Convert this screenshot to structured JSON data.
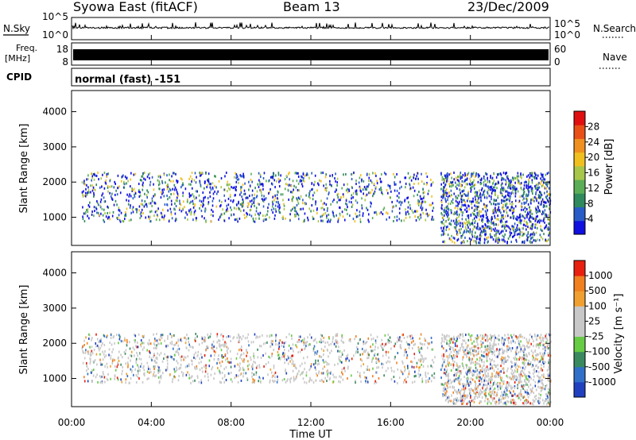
{
  "header": {
    "station": "Syowa East (fitACF)",
    "beam": "Beam 13",
    "date": "23/Dec/2009"
  },
  "top_panels": {
    "nsky_label": "N.Sky",
    "nsky_ticks": [
      "10^5",
      "10^0"
    ],
    "nsearch_label": "N.Search",
    "nsearch_ticks": [
      "10^5",
      "10^0"
    ],
    "freq_label": "Freq.",
    "freq_unit": "[MHz]",
    "freq_ticks": [
      "18",
      "8"
    ],
    "nave_label": "Nave",
    "nave_ticks": [
      "60",
      "0"
    ],
    "cpid_label": "CPID",
    "cpid_value": "normal (fast) -151"
  },
  "chart_data": [
    {
      "type": "heatmap",
      "panel": "power",
      "ylabel": "Slant Range [km]",
      "xlabel": "",
      "y_ticks": [
        "1000",
        "2000",
        "3000",
        "4000"
      ],
      "x_ticks": [
        "00:00",
        "04:00",
        "08:00",
        "12:00",
        "16:00",
        "20:00",
        "00:00"
      ],
      "ylim": [
        200,
        4600
      ],
      "xlim_hours": [
        0,
        24
      ],
      "colorbar": {
        "label": "Power [dB]",
        "ticks": [
          "4",
          "8",
          "12",
          "16",
          "20",
          "24",
          "28"
        ],
        "colors": [
          "#1010e0",
          "#2a5cc8",
          "#2f8a5e",
          "#5cae56",
          "#a8c64a",
          "#f0c020",
          "#f09020",
          "#e85018",
          "#e01010"
        ]
      },
      "scatter_bands": [
        {
          "start_h": 0.5,
          "end_h": 18.2,
          "range_km": [
            900,
            2300
          ]
        },
        {
          "start_h": 18.5,
          "end_h": 24.0,
          "range_km": [
            300,
            2300
          ]
        }
      ]
    },
    {
      "type": "heatmap",
      "panel": "velocity",
      "ylabel": "Slant Range [km]",
      "xlabel": "Time UT",
      "y_ticks": [
        "1000",
        "2000",
        "3000",
        "4000"
      ],
      "x_ticks": [
        "00:00",
        "04:00",
        "08:00",
        "12:00",
        "16:00",
        "20:00",
        "00:00"
      ],
      "ylim": [
        200,
        4600
      ],
      "xlim_hours": [
        0,
        24
      ],
      "colorbar": {
        "label": "Velocity [m s⁻¹]",
        "ticks": [
          "1000",
          "500",
          "100",
          "25",
          "-25",
          "-100",
          "-500",
          "-1000"
        ],
        "colors": [
          "#2040c0",
          "#3070c8",
          "#3a8a60",
          "#66cc44",
          "#c8c8c8",
          "#c8c8c8",
          "#f0a030",
          "#f08020",
          "#e82010"
        ]
      },
      "scatter_bands": [
        {
          "start_h": 0.5,
          "end_h": 18.2,
          "range_km": [
            900,
            2300
          ]
        },
        {
          "start_h": 18.5,
          "end_h": 24.0,
          "range_km": [
            300,
            2300
          ]
        }
      ]
    }
  ]
}
